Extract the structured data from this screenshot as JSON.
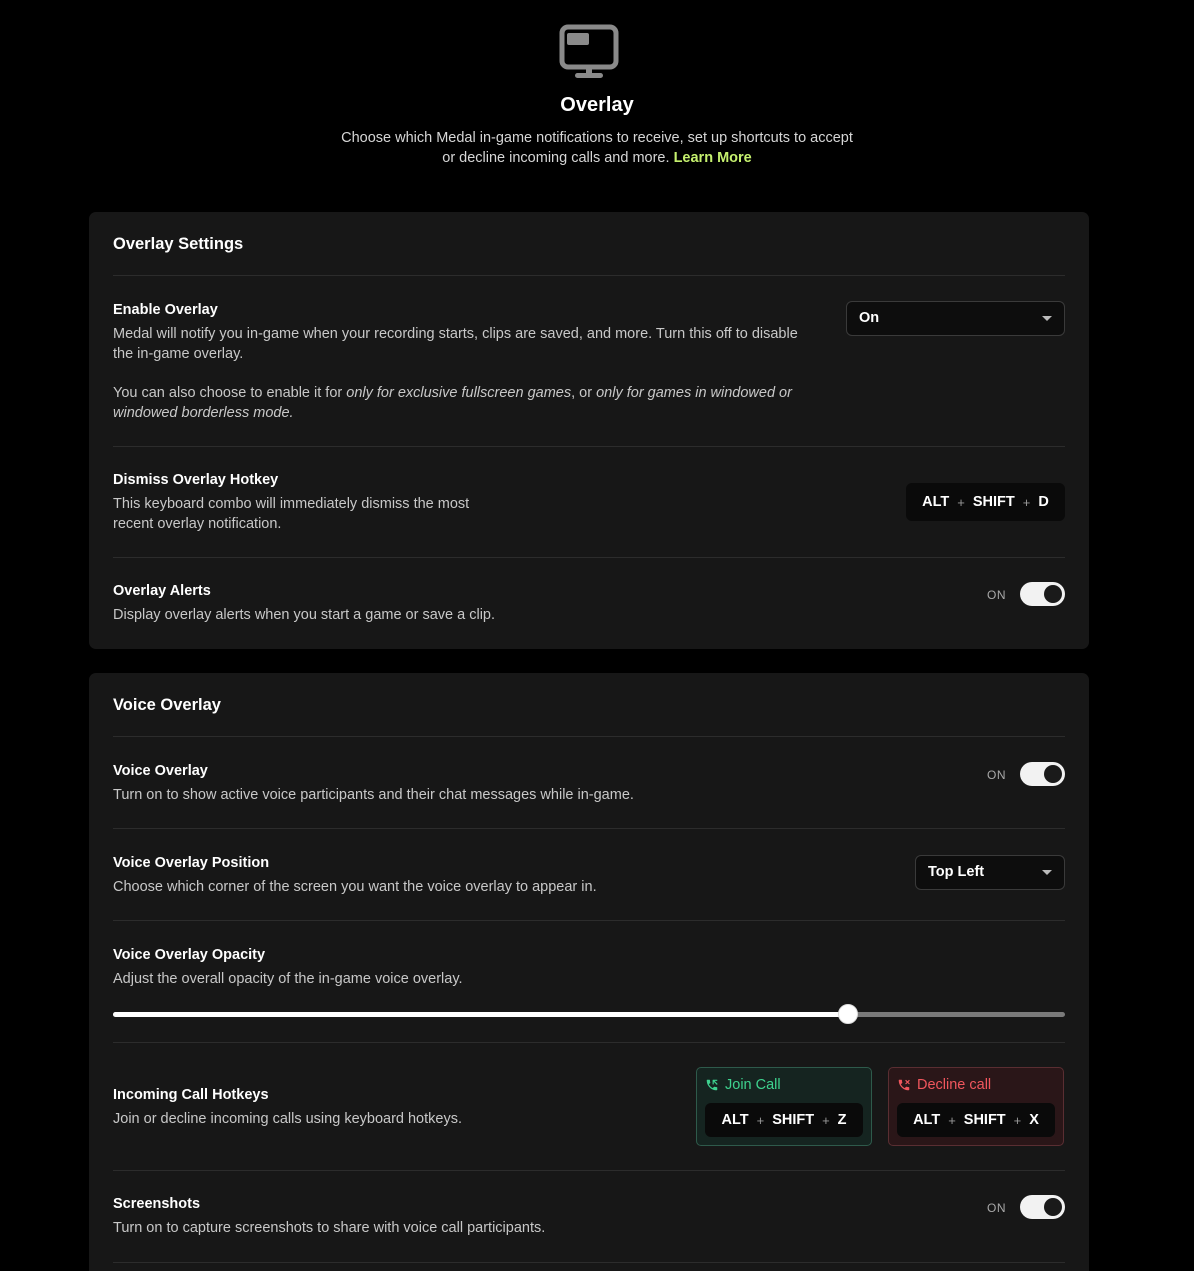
{
  "header": {
    "icon": "monitor-icon",
    "title": "Overlay",
    "description": "Choose which Medal in-game notifications to receive, set up shortcuts to accept or decline incoming calls and more.",
    "learn_more": "Learn More",
    "accent_color": "#c5f06e"
  },
  "overlay_settings": {
    "title": "Overlay Settings",
    "enable_overlay": {
      "title": "Enable Overlay",
      "desc1": "Medal will notify you in-game when your recording starts, clips are saved, and more. Turn this off to disable the in-game overlay.",
      "desc2_a": "You can also choose to enable it for ",
      "desc2_b": "only for exclusive fullscreen games",
      "desc2_c": ", or ",
      "desc2_d": "only for games in windowed or windowed borderless mode.",
      "value": "On"
    },
    "dismiss_hotkey": {
      "title": "Dismiss Overlay Hotkey",
      "desc": "This keyboard combo will immediately dismiss the most recent overlay notification.",
      "keys": [
        "ALT",
        "SHIFT",
        "D"
      ],
      "plus": "+"
    },
    "overlay_alerts": {
      "title": "Overlay Alerts",
      "desc": "Display overlay alerts when you start a game or save a clip.",
      "state_label": "ON",
      "enabled": true
    }
  },
  "voice_overlay": {
    "title": "Voice Overlay",
    "voice_overlay_toggle": {
      "title": "Voice Overlay",
      "desc": "Turn on to show active voice participants and their chat messages while in-game.",
      "state_label": "ON",
      "enabled": true
    },
    "position": {
      "title": "Voice Overlay Position",
      "desc": "Choose which corner of the screen you want the voice overlay to appear in.",
      "value": "Top Left"
    },
    "opacity": {
      "title": "Voice Overlay Opacity",
      "desc": "Adjust the overall opacity of the in-game voice overlay.",
      "value_fraction": 0.772
    },
    "call_hotkeys": {
      "title": "Incoming Call Hotkeys",
      "desc": "Join or decline incoming calls using keyboard hotkeys.",
      "join": {
        "label": "Join Call",
        "keys": [
          "ALT",
          "SHIFT",
          "Z"
        ],
        "color": "#3ed28f",
        "icon": "phone-icon"
      },
      "decline": {
        "label": "Decline call",
        "keys": [
          "ALT",
          "SHIFT",
          "X"
        ],
        "color": "#f0565d",
        "icon": "phone-hangup-icon"
      }
    },
    "screenshots": {
      "title": "Screenshots",
      "desc": "Turn on to capture screenshots to share with voice call participants.",
      "state_label": "ON",
      "enabled": true
    }
  }
}
